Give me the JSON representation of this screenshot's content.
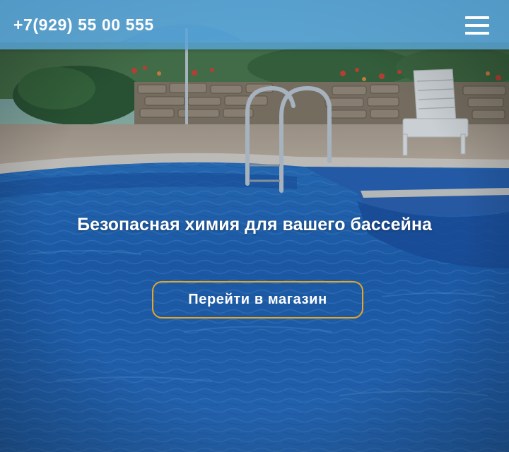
{
  "header": {
    "phone": "+7(929) 55 00 555",
    "menu_icon": "hamburger-menu-icon"
  },
  "hero": {
    "headline": "Безопасная химия для вашего бассейна",
    "cta_label": "Перейти в магазин",
    "background": "outdoor swimming pool photo",
    "colors": {
      "header_bg": "#58a5d7",
      "pool_blue": "#1f63b8",
      "cta_border": "#e3a628",
      "text": "#ffffff"
    }
  }
}
